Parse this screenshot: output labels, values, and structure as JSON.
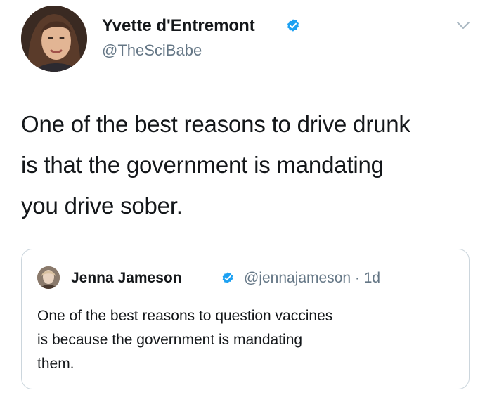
{
  "tweet": {
    "author": {
      "display_name": "Yvette d'Entremont",
      "handle": "@TheSciBabe",
      "verified": true
    },
    "text_lines": [
      "One of the best reasons to drive drunk",
      "is that the government is mandating",
      "you drive sober."
    ],
    "quoted_tweet": {
      "display_name": "Jenna Jameson",
      "handle": "@jennajameson",
      "time": "1d",
      "meta": "@jennajameson · 1d",
      "verified": true,
      "text_lines": [
        "One of the best reasons to question vaccines",
        "is because the government is mandating",
        "them."
      ]
    }
  },
  "icons": {
    "verified": "verified-badge-icon",
    "menu": "chevron-down-icon"
  },
  "colors": {
    "verified_blue": "#1da1f2",
    "text": "#14171a",
    "secondary_text": "#657786",
    "border": "#ccd6dd"
  }
}
